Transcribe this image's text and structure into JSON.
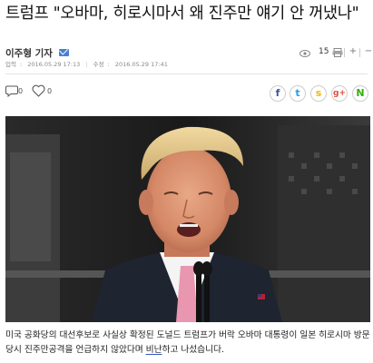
{
  "article": {
    "headline": "트럼프 \"오바마, 히로시마서 왜 진주만 얘기 안 꺼냈나\"",
    "author": "이주형 기자",
    "input_label": "입력",
    "input_time": "2016.05.29 17:13",
    "modified_label": "수정",
    "modified_time": "2016.05.29 17:41",
    "views": "15",
    "caption_prefix": "미국 공화당의 대선후보로 사실상 확정된 도널드 트럼프가 버락 오바마 대통령이 일본 히로시마 방문 당시 진주만공격을 언급하지 않았다며 ",
    "caption_underlined": "비난",
    "caption_suffix": "하고 나섰습니다."
  },
  "actions": {
    "comment_count": "0",
    "like_count": "0"
  },
  "toolbar": {
    "font_up": "+",
    "font_down": "−",
    "print": "⎙",
    "more": "▭"
  },
  "share": {
    "facebook": "f",
    "twitter": "t",
    "kakaostory": "s",
    "googleplus": "g+",
    "naver": "N"
  },
  "icons": {
    "mail": "mail-icon",
    "views": "eye-icon",
    "comment": "comment-icon",
    "like": "heart-icon"
  },
  "colors": {
    "facebook": "#3b5998",
    "twitter": "#1da1f2",
    "kakaostory": "#f2b600",
    "googleplus": "#dd4b39",
    "naver": "#2db400",
    "mail": "#4a7fd4"
  }
}
